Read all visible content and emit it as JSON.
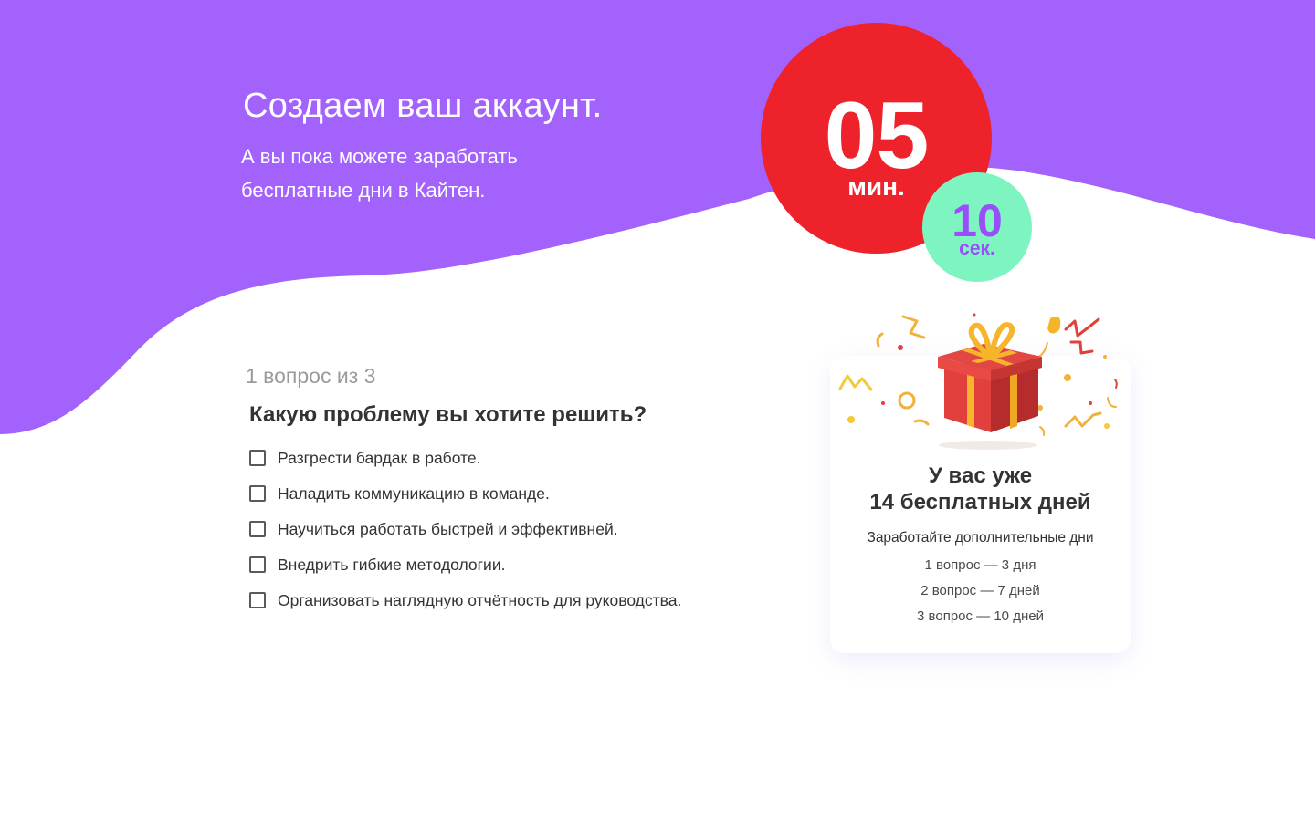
{
  "colors": {
    "brand_purple": "#a362fb",
    "timer_red": "#ee222b",
    "timer_green": "#7ef5c1",
    "seconds_text": "#9a4dfb",
    "gift_red": "#e2403c",
    "ribbon_gold": "#f6b52a"
  },
  "header": {
    "title": "Создаем ваш аккаунт.",
    "subtitle_lines": [
      "А вы пока можете заработать",
      "бесплатные дни в Кайтен."
    ]
  },
  "timer": {
    "minutes": "05",
    "minutes_unit": "мин.",
    "seconds": "10",
    "seconds_unit": "сек."
  },
  "quiz": {
    "progress": "1 вопрос из 3",
    "question": "Какую проблему вы хотите решить?",
    "options": [
      {
        "label": "Разгрести бардак в работе.",
        "checked": false
      },
      {
        "label": "Наладить коммуникацию в команде.",
        "checked": false
      },
      {
        "label": "Научиться работать быстрей и эффективней.",
        "checked": false
      },
      {
        "label": "Внедрить гибкие методологии.",
        "checked": false
      },
      {
        "label": "Организовать наглядную отчётность для руководства.",
        "checked": false
      }
    ]
  },
  "bonus_card": {
    "icon": "gift-icon",
    "title_lines": [
      "У вас уже",
      "14 бесплатных дней"
    ],
    "subtitle": "Заработайте дополнительные дни",
    "rewards": [
      "1 вопрос — 3 дня",
      "2 вопрос — 7 дней",
      "3 вопрос — 10 дней"
    ]
  }
}
